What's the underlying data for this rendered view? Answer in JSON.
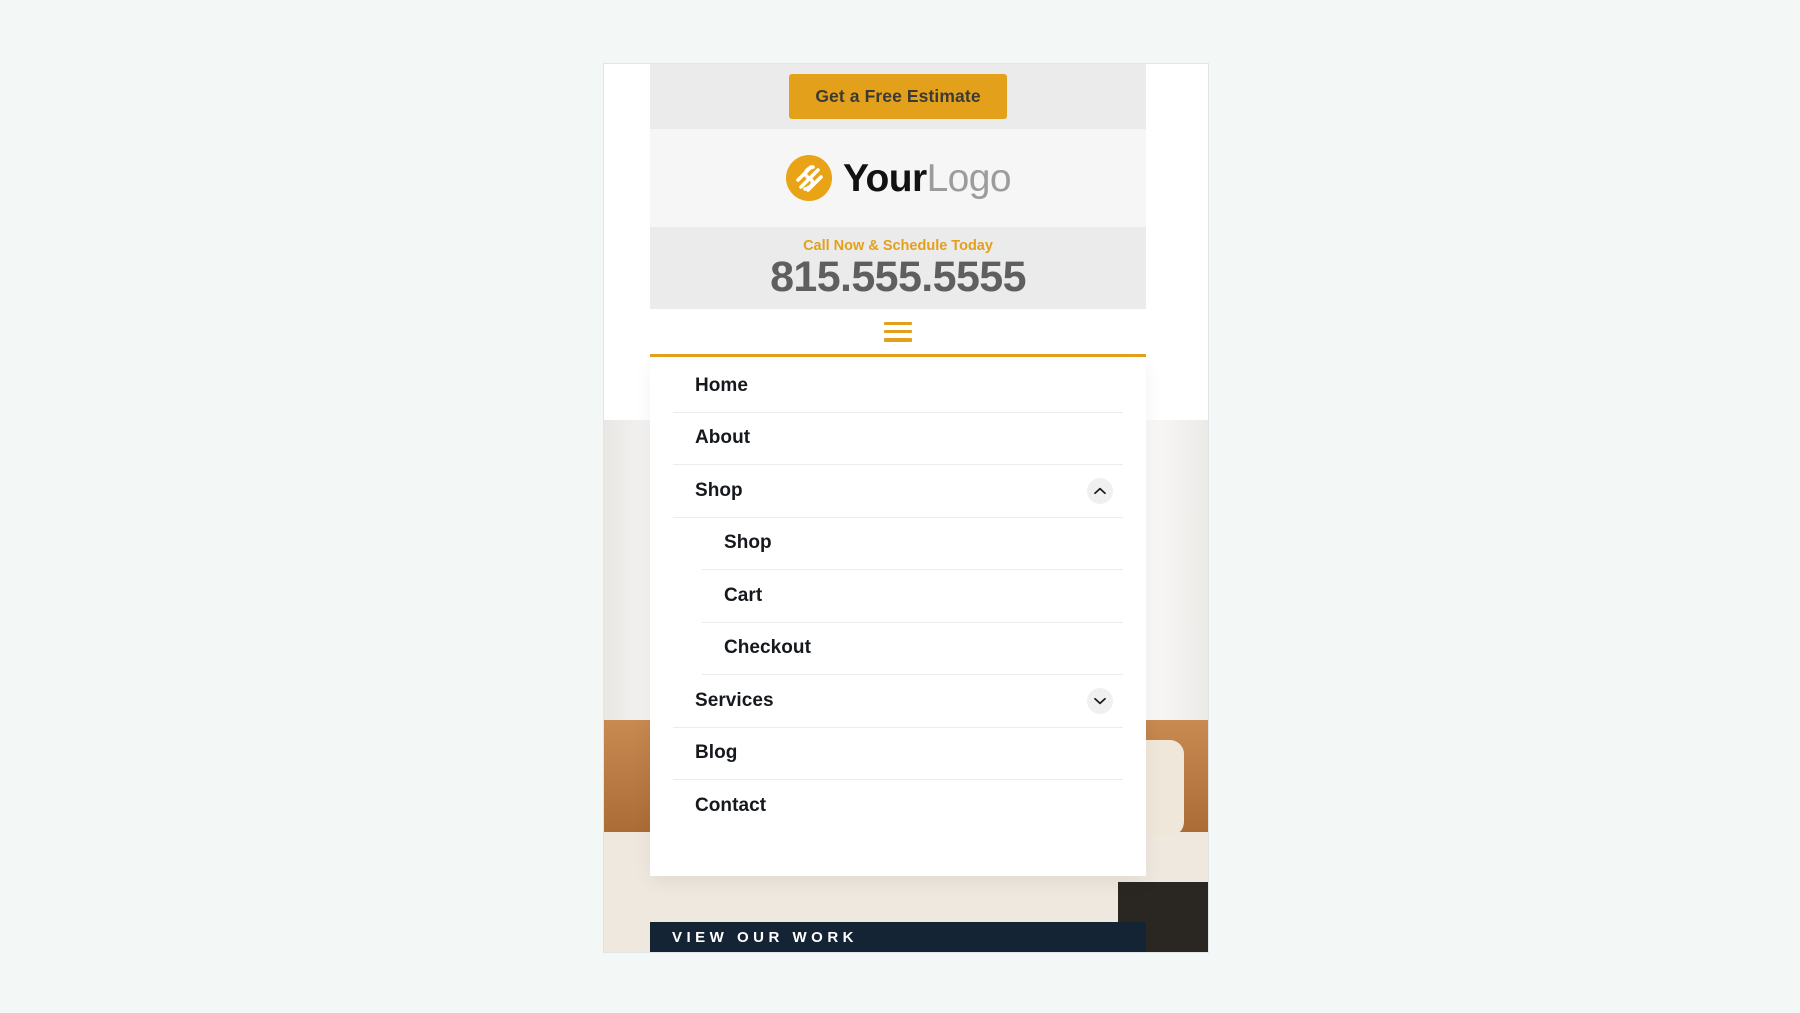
{
  "topbar": {
    "estimate_label": "Get a Free Estimate",
    "accent_color": "#e3a01b"
  },
  "branding": {
    "logo_icon": "circle-swirl-logo-icon",
    "name_bold": "Your",
    "name_light": "Logo",
    "logo_circle_color": "#e8a317"
  },
  "contact": {
    "tagline": "Call Now & Schedule Today",
    "phone": "815.555.5555",
    "tagline_color": "#e3a01b",
    "phone_color": "#5f5f5f"
  },
  "nav": {
    "toggle_icon": "hamburger-menu-icon",
    "toggle_color": "#e3a01b",
    "items": [
      {
        "label": "Home",
        "has_children": false,
        "expanded": false,
        "icon": ""
      },
      {
        "label": "About",
        "has_children": false,
        "expanded": false,
        "icon": ""
      },
      {
        "label": "Shop",
        "has_children": true,
        "expanded": true,
        "icon": "chevron-up-icon"
      },
      {
        "label": "Services",
        "has_children": true,
        "expanded": false,
        "icon": "chevron-down-icon"
      },
      {
        "label": "Blog",
        "has_children": false,
        "expanded": false,
        "icon": ""
      },
      {
        "label": "Contact",
        "has_children": false,
        "expanded": false,
        "icon": ""
      }
    ],
    "shop_submenu": [
      {
        "label": "Shop"
      },
      {
        "label": "Cart"
      },
      {
        "label": "Checkout"
      }
    ]
  },
  "hero": {
    "banner_label": "VIEW OUR WORK",
    "banner_bg": "#152434"
  }
}
